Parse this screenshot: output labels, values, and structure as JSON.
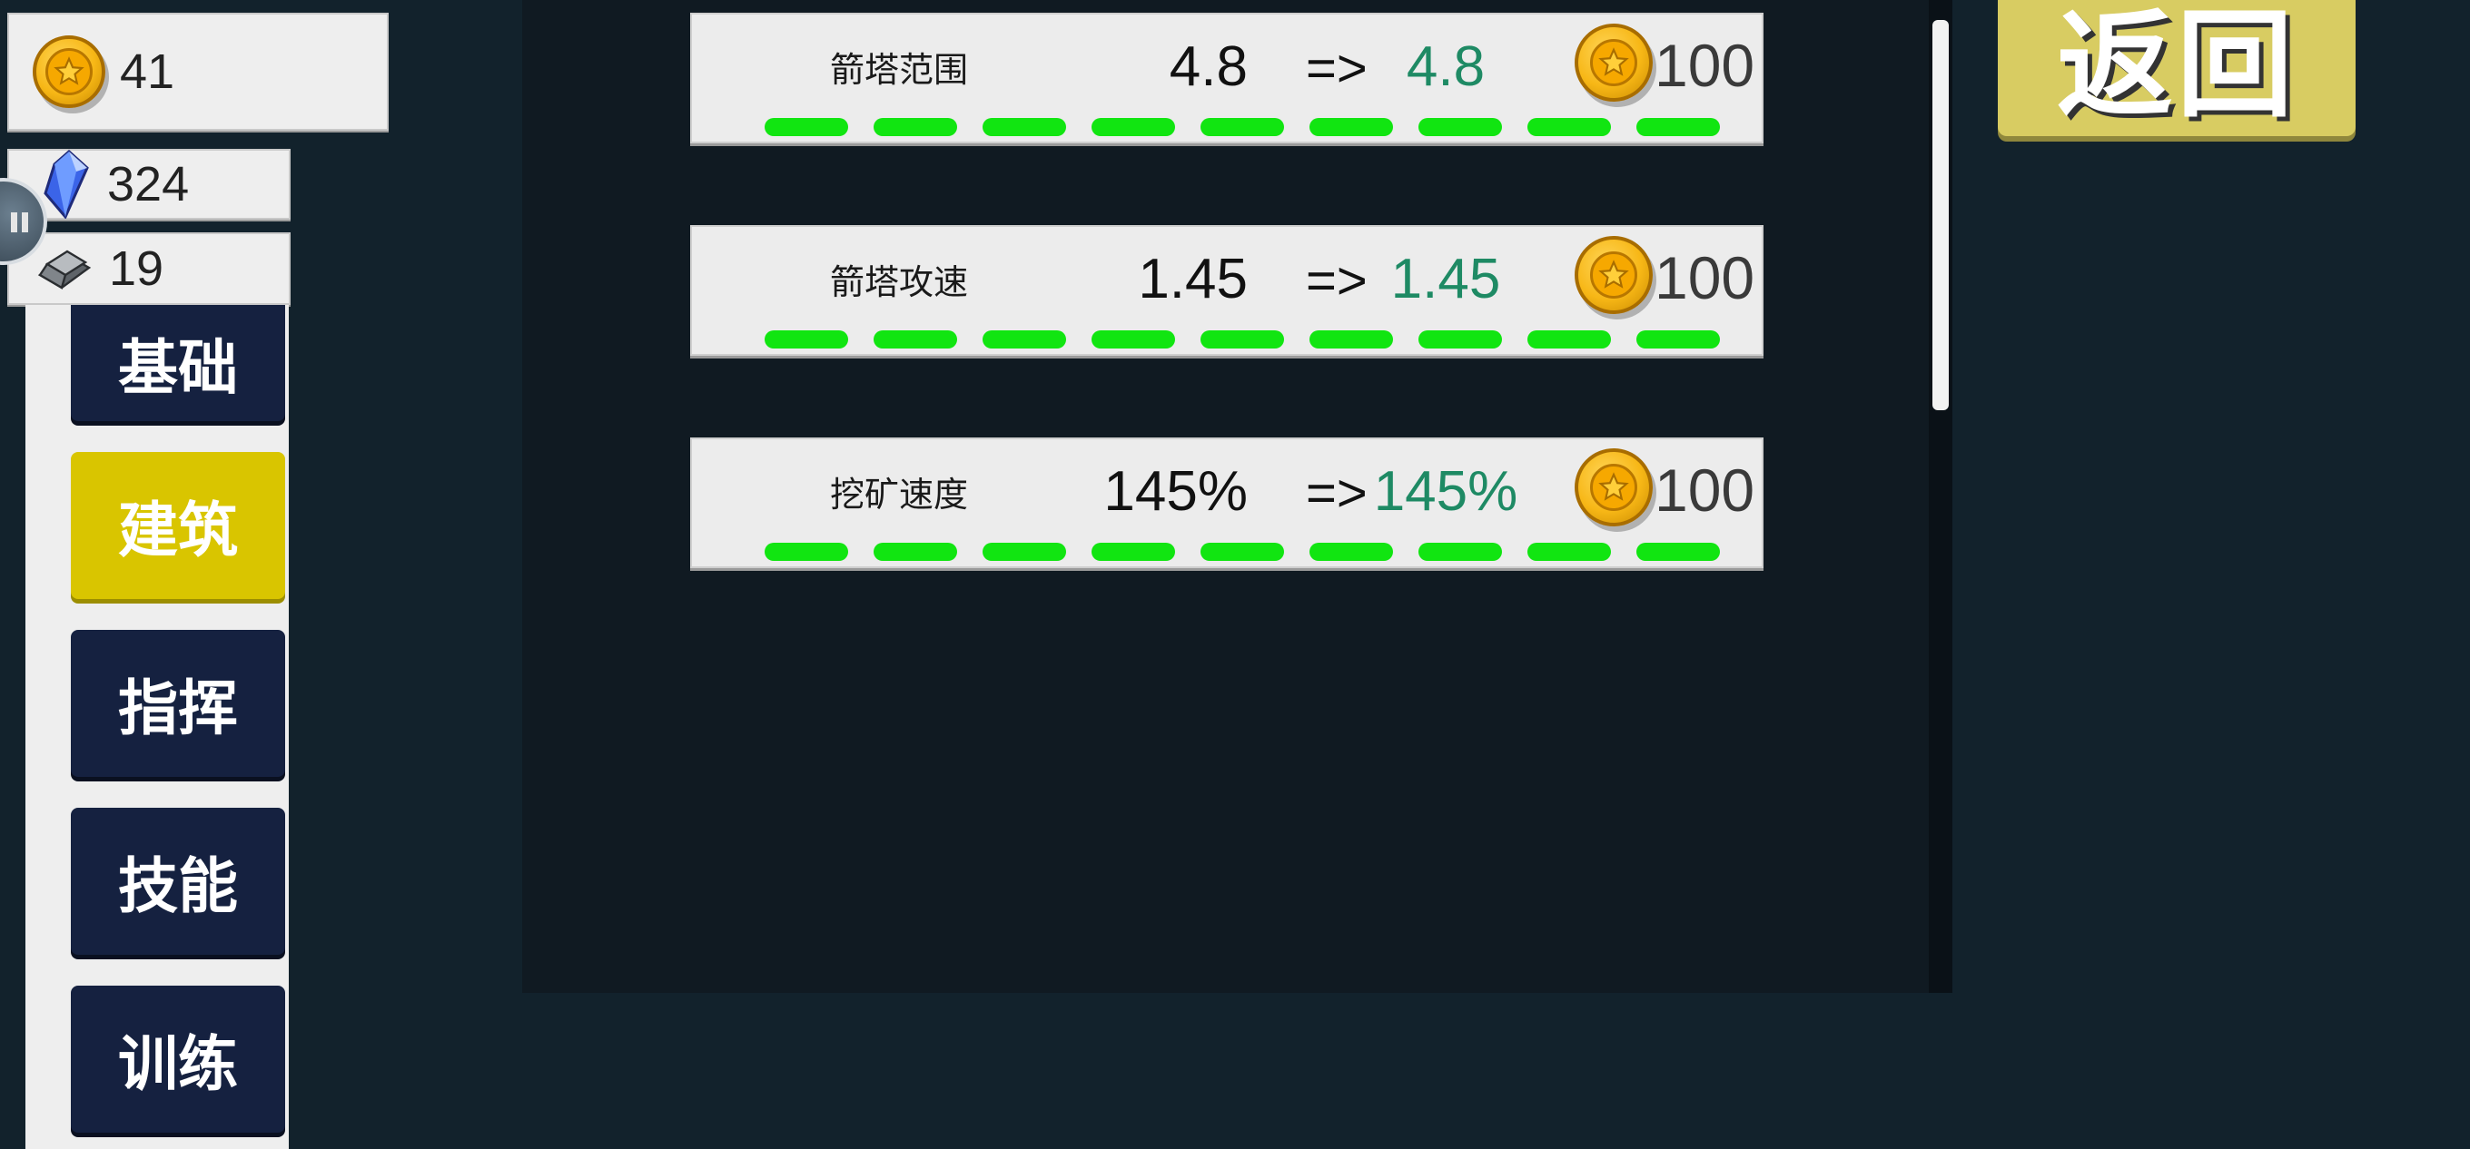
{
  "currencies": {
    "gold": {
      "value": "41",
      "icon": "gold-coin-icon"
    },
    "gem": {
      "value": "324",
      "icon": "blue-crystal-icon"
    },
    "iron": {
      "value": "19",
      "icon": "iron-ingot-icon"
    }
  },
  "menu": {
    "items": [
      {
        "label": "基础",
        "active": false
      },
      {
        "label": "建筑",
        "active": true
      },
      {
        "label": "指挥",
        "active": false
      },
      {
        "label": "技能",
        "active": false
      },
      {
        "label": "训练",
        "active": false
      }
    ]
  },
  "upgrades": [
    {
      "name": "箭塔范围",
      "current": "4.8",
      "arrow": "=>",
      "next": "4.8",
      "price": "100",
      "level_segments": 9
    },
    {
      "name": "箭塔攻速",
      "current": "1.45",
      "arrow": "=>",
      "next": "1.45",
      "price": "100",
      "level_segments": 9
    },
    {
      "name": "挖矿速度",
      "current": "145%",
      "arrow": "=>",
      "next": "145%",
      "price": "100",
      "level_segments": 9
    }
  ],
  "back_button": {
    "label": "返回"
  },
  "colors": {
    "background": "#12222c",
    "menu_inactive": "#152140",
    "menu_active": "#d9c500",
    "next_value": "#1e8a64",
    "level_segment": "#11e511",
    "back_button": "#d8cc62"
  }
}
